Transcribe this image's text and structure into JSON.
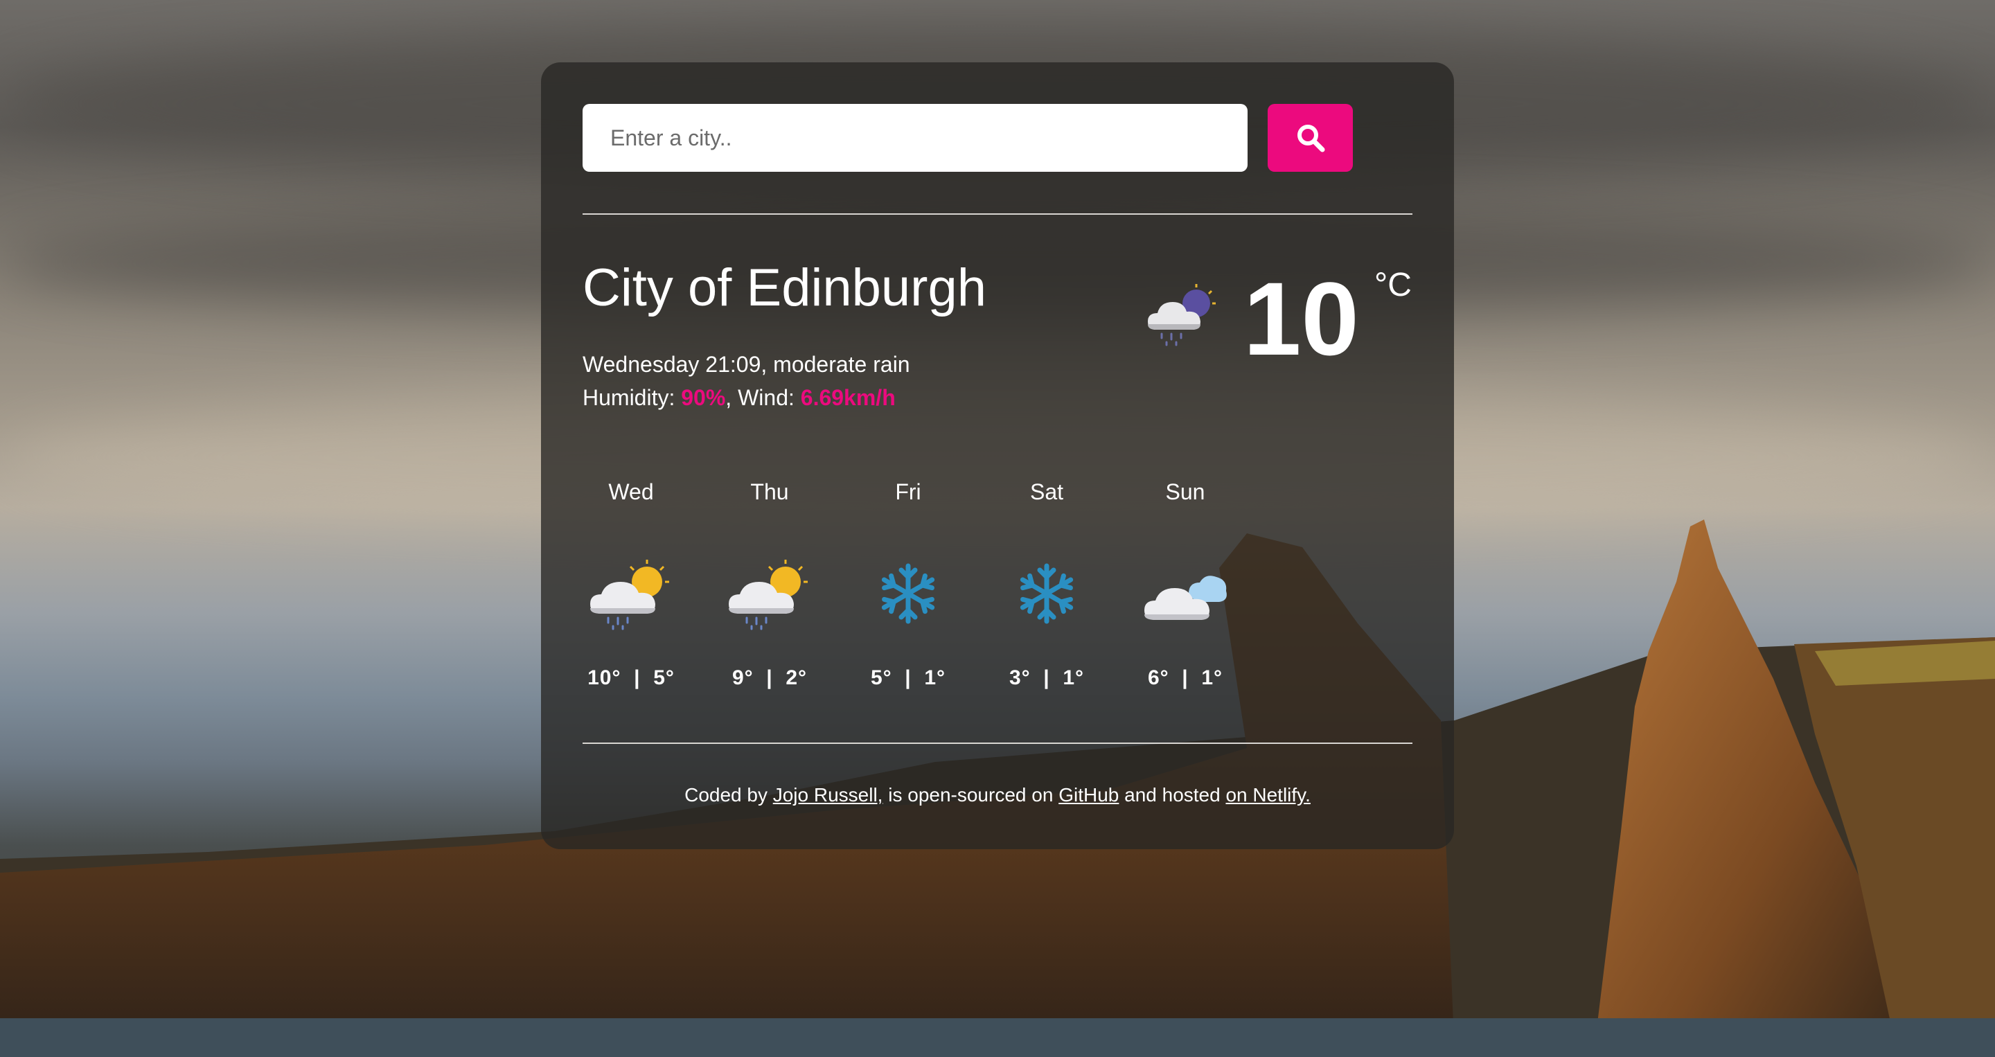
{
  "search": {
    "placeholder": "Enter a city.."
  },
  "current": {
    "city": "City of Edinburgh",
    "day_time_desc": "Wednesday 21:09, moderate rain",
    "humidity_label": "Humidity: ",
    "humidity": "90%",
    "wind_label": ", Wind: ",
    "wind": "6.69km/h",
    "temp": "10",
    "unit": "°C",
    "icon": "night-cloud-rain-icon"
  },
  "forecast": [
    {
      "day": "Wed",
      "high": "10°",
      "sep": "|",
      "low": "5°",
      "icon": "sun-cloud-rain-icon"
    },
    {
      "day": "Thu",
      "high": "9°",
      "sep": "|",
      "low": "2°",
      "icon": "sun-cloud-rain-icon"
    },
    {
      "day": "Fri",
      "high": "5°",
      "sep": "|",
      "low": "1°",
      "icon": "snowflake-icon"
    },
    {
      "day": "Sat",
      "high": "3°",
      "sep": "|",
      "low": "1°",
      "icon": "snowflake-icon"
    },
    {
      "day": "Sun",
      "high": "6°",
      "sep": "|",
      "low": "1°",
      "icon": "cloudy-icon"
    }
  ],
  "footer": {
    "coded_by": "Coded by ",
    "author": "Jojo Russell,",
    "open_sourced": " is open-sourced on ",
    "github": "GitHub",
    "hosted": " and hosted ",
    "netlify": "on Netlify."
  },
  "colors": {
    "accent": "#ec0a7e",
    "card": "rgba(40,38,36,0.78)"
  }
}
